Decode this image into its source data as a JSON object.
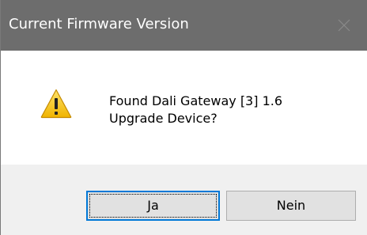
{
  "window": {
    "title": "Current Firmware Version",
    "close_icon": "close-icon"
  },
  "message": {
    "icon": "warning-icon",
    "line1": "Found Dali Gateway [3] 1.6",
    "line2": "Upgrade Device?"
  },
  "buttons": {
    "yes_label": "Ja",
    "no_label": "Nein"
  },
  "colors": {
    "titlebar": "#6d6d6d",
    "content_bg": "#ffffff",
    "footer_bg": "#f0f0f0",
    "focus_border": "#0078d7",
    "warning_yellow": "#f5c518"
  }
}
